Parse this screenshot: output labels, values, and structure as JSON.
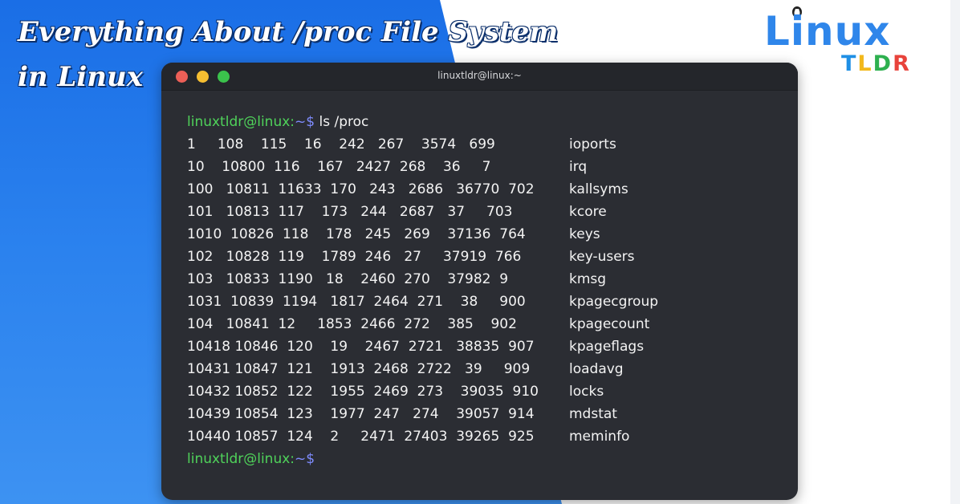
{
  "headline": {
    "line1": "Everything About /proc File System",
    "line2": "in Linux"
  },
  "logo": {
    "word": "Linux",
    "tldr": [
      "T",
      "L",
      "D",
      "R"
    ]
  },
  "colors": {
    "background_blue": "#2b82ee",
    "terminal_bg": "#2b2d33",
    "prompt_green": "#4fd25a"
  },
  "terminal": {
    "title": "linuxtldr@linux:~",
    "prompt_user": "linuxtldr@linux:",
    "prompt_tail": "~$",
    "command": " ls /proc",
    "rows": [
      {
        "nums": "1     108    115    16    242   267    3574   699",
        "name": "ioports"
      },
      {
        "nums": "10    10800  116    167   2427  268    36     7",
        "name": "irq"
      },
      {
        "nums": "100   10811  11633  170   243   2686   36770  702",
        "name": "kallsyms"
      },
      {
        "nums": "101   10813  117    173   244   2687   37     703",
        "name": "kcore"
      },
      {
        "nums": "1010  10826  118    178   245   269    37136  764",
        "name": "keys"
      },
      {
        "nums": "102   10828  119    1789  246   27     37919  766",
        "name": "key-users"
      },
      {
        "nums": "103   10833  1190   18    2460  270    37982  9",
        "name": "kmsg"
      },
      {
        "nums": "1031  10839  1194   1817  2464  271    38     900",
        "name": "kpagecgroup"
      },
      {
        "nums": "104   10841  12     1853  2466  272    385    902",
        "name": "kpagecount"
      },
      {
        "nums": "10418 10846  120    19    2467  2721   38835  907",
        "name": "kpageflags"
      },
      {
        "nums": "10431 10847  121    1913  2468  2722   39     909",
        "name": "loadavg"
      },
      {
        "nums": "10432 10852  122    1955  2469  273    39035  910",
        "name": "locks"
      },
      {
        "nums": "10439 10854  123    1977  247   274    39057  914",
        "name": "mdstat"
      },
      {
        "nums": "10440 10857  124    2     2471  27403  39265  925",
        "name": "meminfo"
      }
    ]
  }
}
